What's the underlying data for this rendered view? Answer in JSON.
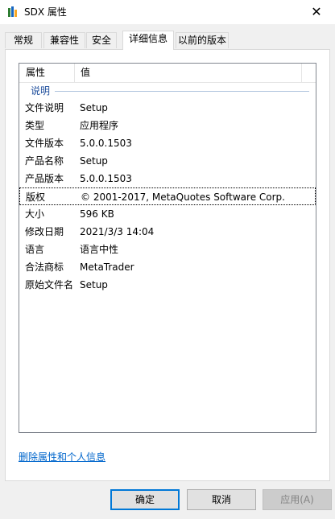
{
  "window": {
    "title": "SDX 属性",
    "close_glyph": "✕"
  },
  "tabs": [
    {
      "label": "常规",
      "active": false
    },
    {
      "label": "兼容性",
      "active": false
    },
    {
      "label": "安全",
      "active": false
    },
    {
      "label": "详细信息",
      "active": true
    },
    {
      "label": "以前的版本",
      "active": false
    }
  ],
  "details": {
    "columns": {
      "property": "属性",
      "value": "值"
    },
    "group_label": "说明",
    "rows": [
      {
        "property": "文件说明",
        "value": "Setup"
      },
      {
        "property": "类型",
        "value": "应用程序"
      },
      {
        "property": "文件版本",
        "value": "5.0.0.1503"
      },
      {
        "property": "产品名称",
        "value": "Setup"
      },
      {
        "property": "产品版本",
        "value": "5.0.0.1503"
      },
      {
        "property": "版权",
        "value": "© 2001-2017, MetaQuotes Software Corp."
      },
      {
        "property": "大小",
        "value": "596 KB"
      },
      {
        "property": "修改日期",
        "value": "2021/3/3 14:04"
      },
      {
        "property": "语言",
        "value": "语言中性"
      },
      {
        "property": "合法商标",
        "value": "MetaTrader"
      },
      {
        "property": "原始文件名",
        "value": "Setup"
      }
    ]
  },
  "remove_link": "删除属性和个人信息",
  "buttons": {
    "ok": "确定",
    "cancel": "取消",
    "apply": "应用(A)"
  },
  "colors": {
    "link": "#0066cc",
    "default_button_border": "#0078d7",
    "group_label": "#1e4e9c"
  }
}
